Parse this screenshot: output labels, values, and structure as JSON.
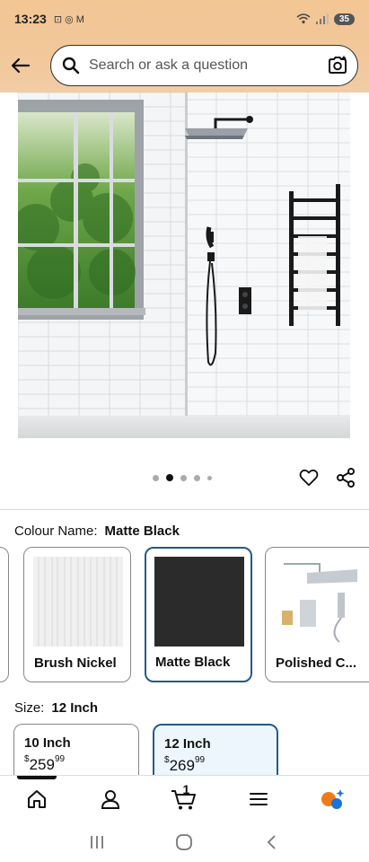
{
  "status_bar": {
    "time": "13:23",
    "notif_icons": "⊡ ◎ M",
    "battery": "35"
  },
  "search": {
    "placeholder": "Search or ask a question"
  },
  "carousel": {
    "dot_count": 5,
    "active_index": 1
  },
  "colour": {
    "label": "Colour Name:",
    "selected": "Matte Black",
    "options": [
      {
        "name": "Brush Nickel"
      },
      {
        "name": "Matte Black"
      },
      {
        "name": "Polished C..."
      }
    ]
  },
  "size": {
    "label": "Size:",
    "selected": "12 Inch",
    "options": [
      {
        "name": "10 Inch",
        "currency": "$",
        "price_whole": "259",
        "price_fraction": "99"
      },
      {
        "name": "12 Inch",
        "currency": "$",
        "price_whole": "269",
        "price_fraction": "99"
      }
    ]
  },
  "bottom_nav": {
    "cart_count": "1",
    "items": [
      "home-icon",
      "account-icon",
      "cart-icon",
      "menu-icon",
      "rufus-icon"
    ]
  },
  "colors": {
    "header_bg": "#f3c694",
    "selected_border": "#245b86",
    "selected_bg": "#edf6fd",
    "rufus_orange": "#f07a1a",
    "rufus_blue": "#1a73d6"
  }
}
